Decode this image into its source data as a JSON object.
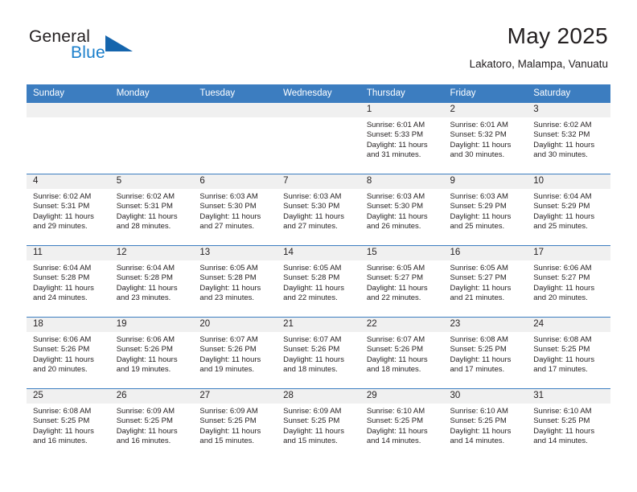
{
  "brand": {
    "word_general": "General",
    "word_blue": "Blue",
    "accent_color": "#1565ad",
    "blue_text_color": "#1b7fcb"
  },
  "header": {
    "month_title": "May 2025",
    "location": "Lakatoro, Malampa, Vanuatu",
    "header_bg_color": "#3c7dc0",
    "daynum_bg_color": "#f0f0f0"
  },
  "weekday_headers": [
    "Sunday",
    "Monday",
    "Tuesday",
    "Wednesday",
    "Thursday",
    "Friday",
    "Saturday"
  ],
  "weeks": [
    [
      {
        "day": "",
        "empty": true
      },
      {
        "day": "",
        "empty": true
      },
      {
        "day": "",
        "empty": true
      },
      {
        "day": "",
        "empty": true
      },
      {
        "day": "1",
        "sunrise": "Sunrise: 6:01 AM",
        "sunset": "Sunset: 5:33 PM",
        "daylight1": "Daylight: 11 hours",
        "daylight2": "and 31 minutes."
      },
      {
        "day": "2",
        "sunrise": "Sunrise: 6:01 AM",
        "sunset": "Sunset: 5:32 PM",
        "daylight1": "Daylight: 11 hours",
        "daylight2": "and 30 minutes."
      },
      {
        "day": "3",
        "sunrise": "Sunrise: 6:02 AM",
        "sunset": "Sunset: 5:32 PM",
        "daylight1": "Daylight: 11 hours",
        "daylight2": "and 30 minutes."
      }
    ],
    [
      {
        "day": "4",
        "sunrise": "Sunrise: 6:02 AM",
        "sunset": "Sunset: 5:31 PM",
        "daylight1": "Daylight: 11 hours",
        "daylight2": "and 29 minutes."
      },
      {
        "day": "5",
        "sunrise": "Sunrise: 6:02 AM",
        "sunset": "Sunset: 5:31 PM",
        "daylight1": "Daylight: 11 hours",
        "daylight2": "and 28 minutes."
      },
      {
        "day": "6",
        "sunrise": "Sunrise: 6:03 AM",
        "sunset": "Sunset: 5:30 PM",
        "daylight1": "Daylight: 11 hours",
        "daylight2": "and 27 minutes."
      },
      {
        "day": "7",
        "sunrise": "Sunrise: 6:03 AM",
        "sunset": "Sunset: 5:30 PM",
        "daylight1": "Daylight: 11 hours",
        "daylight2": "and 27 minutes."
      },
      {
        "day": "8",
        "sunrise": "Sunrise: 6:03 AM",
        "sunset": "Sunset: 5:30 PM",
        "daylight1": "Daylight: 11 hours",
        "daylight2": "and 26 minutes."
      },
      {
        "day": "9",
        "sunrise": "Sunrise: 6:03 AM",
        "sunset": "Sunset: 5:29 PM",
        "daylight1": "Daylight: 11 hours",
        "daylight2": "and 25 minutes."
      },
      {
        "day": "10",
        "sunrise": "Sunrise: 6:04 AM",
        "sunset": "Sunset: 5:29 PM",
        "daylight1": "Daylight: 11 hours",
        "daylight2": "and 25 minutes."
      }
    ],
    [
      {
        "day": "11",
        "sunrise": "Sunrise: 6:04 AM",
        "sunset": "Sunset: 5:28 PM",
        "daylight1": "Daylight: 11 hours",
        "daylight2": "and 24 minutes."
      },
      {
        "day": "12",
        "sunrise": "Sunrise: 6:04 AM",
        "sunset": "Sunset: 5:28 PM",
        "daylight1": "Daylight: 11 hours",
        "daylight2": "and 23 minutes."
      },
      {
        "day": "13",
        "sunrise": "Sunrise: 6:05 AM",
        "sunset": "Sunset: 5:28 PM",
        "daylight1": "Daylight: 11 hours",
        "daylight2": "and 23 minutes."
      },
      {
        "day": "14",
        "sunrise": "Sunrise: 6:05 AM",
        "sunset": "Sunset: 5:28 PM",
        "daylight1": "Daylight: 11 hours",
        "daylight2": "and 22 minutes."
      },
      {
        "day": "15",
        "sunrise": "Sunrise: 6:05 AM",
        "sunset": "Sunset: 5:27 PM",
        "daylight1": "Daylight: 11 hours",
        "daylight2": "and 22 minutes."
      },
      {
        "day": "16",
        "sunrise": "Sunrise: 6:05 AM",
        "sunset": "Sunset: 5:27 PM",
        "daylight1": "Daylight: 11 hours",
        "daylight2": "and 21 minutes."
      },
      {
        "day": "17",
        "sunrise": "Sunrise: 6:06 AM",
        "sunset": "Sunset: 5:27 PM",
        "daylight1": "Daylight: 11 hours",
        "daylight2": "and 20 minutes."
      }
    ],
    [
      {
        "day": "18",
        "sunrise": "Sunrise: 6:06 AM",
        "sunset": "Sunset: 5:26 PM",
        "daylight1": "Daylight: 11 hours",
        "daylight2": "and 20 minutes."
      },
      {
        "day": "19",
        "sunrise": "Sunrise: 6:06 AM",
        "sunset": "Sunset: 5:26 PM",
        "daylight1": "Daylight: 11 hours",
        "daylight2": "and 19 minutes."
      },
      {
        "day": "20",
        "sunrise": "Sunrise: 6:07 AM",
        "sunset": "Sunset: 5:26 PM",
        "daylight1": "Daylight: 11 hours",
        "daylight2": "and 19 minutes."
      },
      {
        "day": "21",
        "sunrise": "Sunrise: 6:07 AM",
        "sunset": "Sunset: 5:26 PM",
        "daylight1": "Daylight: 11 hours",
        "daylight2": "and 18 minutes."
      },
      {
        "day": "22",
        "sunrise": "Sunrise: 6:07 AM",
        "sunset": "Sunset: 5:26 PM",
        "daylight1": "Daylight: 11 hours",
        "daylight2": "and 18 minutes."
      },
      {
        "day": "23",
        "sunrise": "Sunrise: 6:08 AM",
        "sunset": "Sunset: 5:25 PM",
        "daylight1": "Daylight: 11 hours",
        "daylight2": "and 17 minutes."
      },
      {
        "day": "24",
        "sunrise": "Sunrise: 6:08 AM",
        "sunset": "Sunset: 5:25 PM",
        "daylight1": "Daylight: 11 hours",
        "daylight2": "and 17 minutes."
      }
    ],
    [
      {
        "day": "25",
        "sunrise": "Sunrise: 6:08 AM",
        "sunset": "Sunset: 5:25 PM",
        "daylight1": "Daylight: 11 hours",
        "daylight2": "and 16 minutes."
      },
      {
        "day": "26",
        "sunrise": "Sunrise: 6:09 AM",
        "sunset": "Sunset: 5:25 PM",
        "daylight1": "Daylight: 11 hours",
        "daylight2": "and 16 minutes."
      },
      {
        "day": "27",
        "sunrise": "Sunrise: 6:09 AM",
        "sunset": "Sunset: 5:25 PM",
        "daylight1": "Daylight: 11 hours",
        "daylight2": "and 15 minutes."
      },
      {
        "day": "28",
        "sunrise": "Sunrise: 6:09 AM",
        "sunset": "Sunset: 5:25 PM",
        "daylight1": "Daylight: 11 hours",
        "daylight2": "and 15 minutes."
      },
      {
        "day": "29",
        "sunrise": "Sunrise: 6:10 AM",
        "sunset": "Sunset: 5:25 PM",
        "daylight1": "Daylight: 11 hours",
        "daylight2": "and 14 minutes."
      },
      {
        "day": "30",
        "sunrise": "Sunrise: 6:10 AM",
        "sunset": "Sunset: 5:25 PM",
        "daylight1": "Daylight: 11 hours",
        "daylight2": "and 14 minutes."
      },
      {
        "day": "31",
        "sunrise": "Sunrise: 6:10 AM",
        "sunset": "Sunset: 5:25 PM",
        "daylight1": "Daylight: 11 hours",
        "daylight2": "and 14 minutes."
      }
    ]
  ]
}
